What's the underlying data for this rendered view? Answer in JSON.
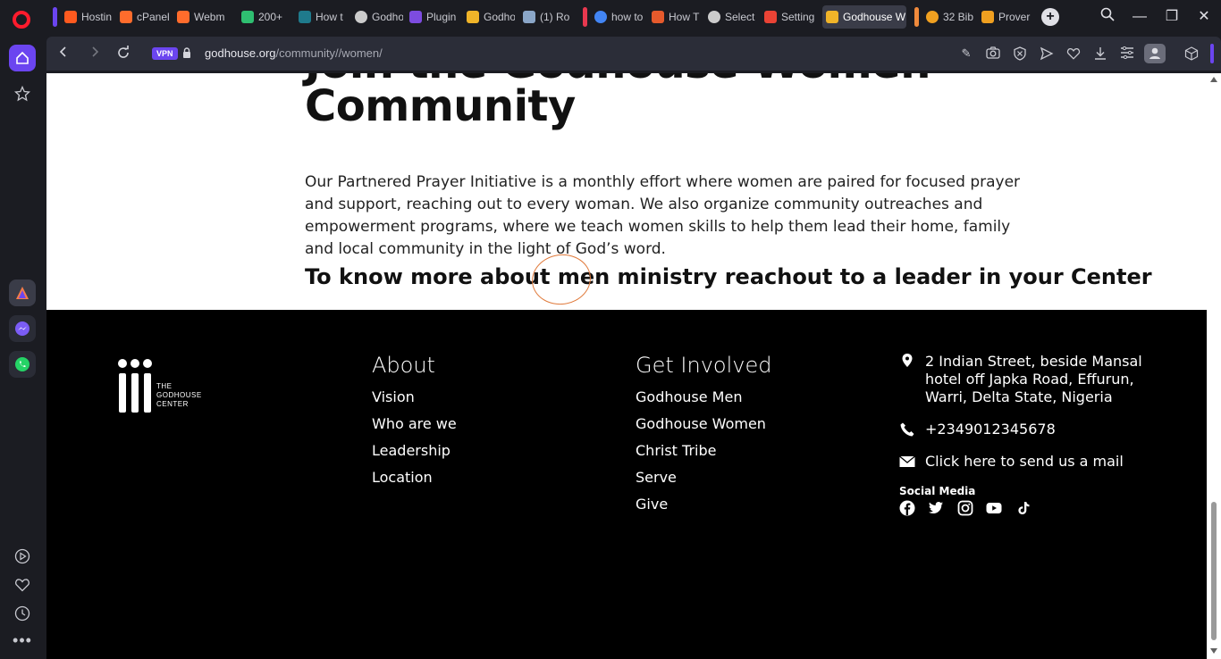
{
  "tabs": [
    {
      "label": "Hostin",
      "color": "#ff5a1f"
    },
    {
      "label": "cPanel",
      "color": "#ff6c2c"
    },
    {
      "label": "Webm",
      "color": "#ff6c2c"
    },
    {
      "label": "200+",
      "color": "#2fbf71"
    },
    {
      "label": "How t",
      "color": "#1f7a8c"
    },
    {
      "label": "Godho",
      "color": "#cccccc"
    },
    {
      "label": "Plugin",
      "color": "#7d4ce0"
    },
    {
      "label": "Godho",
      "color": "#f0b429"
    },
    {
      "label": "(1) Ro",
      "color": "#8aa6c8"
    },
    {
      "label": "how to",
      "color": "#4285f4"
    },
    {
      "label": "How T",
      "color": "#e65a2c"
    },
    {
      "label": "Select",
      "color": "#cccccc"
    },
    {
      "label": "Setting",
      "color": "#ea4335"
    },
    {
      "label": "Godhouse W",
      "color": "#f0b429"
    },
    {
      "label": "32 Bib",
      "color": "#f0a020"
    },
    {
      "label": "Prover",
      "color": "#f0a020"
    }
  ],
  "address": {
    "vpn": "VPN",
    "domain": "godhouse.org",
    "path": "/community//women/"
  },
  "page": {
    "heading_partial": "Join the Godhouse Women",
    "heading_line2": "Community",
    "paragraph": "Our Partnered Prayer Initiative is a monthly effort where women are paired for focused prayer and support, reaching out to every woman. We also organize community outreaches and empowerment programs, where we teach women skills to help them lead their home, family and local community in the light of God’s word.",
    "cta": "To know more about men ministry reachout to a leader in your Center"
  },
  "footer": {
    "logo_text_1": "THE",
    "logo_text_2": "GODHOUSE",
    "logo_text_3": "CENTER",
    "about_title": "About",
    "about_links": [
      "Vision",
      "Who are we",
      "Leadership",
      "Location"
    ],
    "involved_title": "Get Involved",
    "involved_links": [
      "Godhouse Men",
      "Godhouse Women",
      "Christ Tribe",
      "Serve",
      "Give"
    ],
    "address_line1": "2 Indian Street, beside Mansal",
    "address_line2": "hotel off Japka Road, Effurun,",
    "address_line3": "Warri, Delta State, Nigeria",
    "phone": "+2349012345678",
    "mail": "Click here to send us a mail",
    "social_title": "Social Media"
  }
}
